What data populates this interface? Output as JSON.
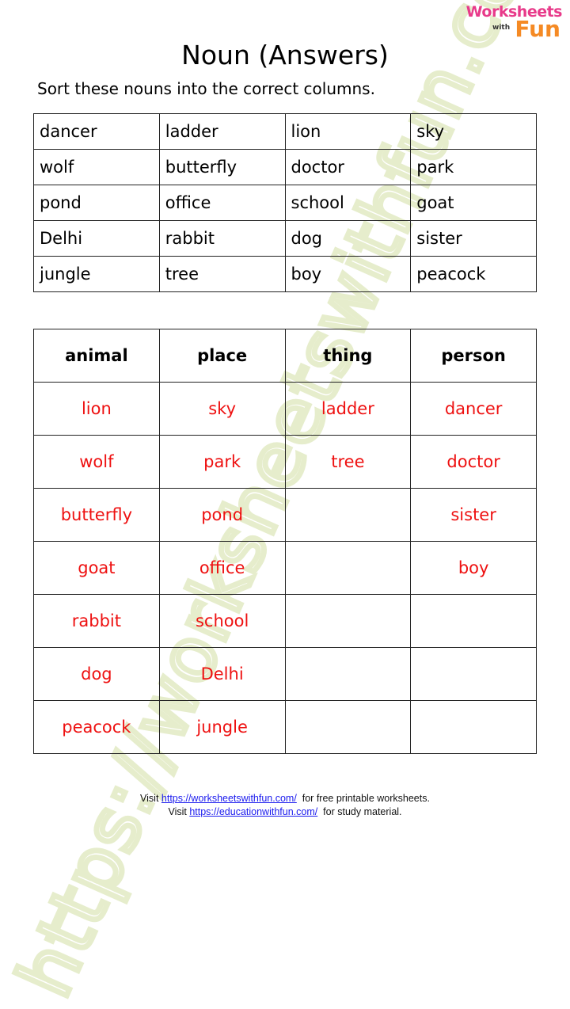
{
  "watermark": "https://worksheetswithfun.com",
  "logo": {
    "line1": "Worksheets",
    "line2": "with",
    "line3": "Fun"
  },
  "title": "Noun (Answers)",
  "instruction": "Sort these nouns into the correct columns.",
  "word_table": [
    [
      "dancer",
      "ladder",
      "lion",
      "sky"
    ],
    [
      "wolf",
      "butterfly",
      "doctor",
      "park"
    ],
    [
      "pond",
      "office",
      "school",
      "goat"
    ],
    [
      "Delhi",
      "rabbit",
      "dog",
      "sister"
    ],
    [
      "jungle",
      "tree",
      "boy",
      "peacock"
    ]
  ],
  "answer_table": {
    "headers": [
      "animal",
      "place",
      "thing",
      "person"
    ],
    "rows": [
      [
        "lion",
        "sky",
        "ladder",
        "dancer"
      ],
      [
        "wolf",
        "park",
        "tree",
        "doctor"
      ],
      [
        "butterfly",
        "pond",
        "",
        "sister"
      ],
      [
        "goat",
        "office",
        "",
        "boy"
      ],
      [
        "rabbit",
        "school",
        "",
        ""
      ],
      [
        "dog",
        "Delhi",
        "",
        ""
      ],
      [
        "peacock",
        "jungle",
        "",
        ""
      ]
    ]
  },
  "footer": {
    "line1_prefix": "Visit ",
    "line1_link": "https://worksheetswithfun.com/",
    "line1_suffix": "  for free printable worksheets.",
    "line2_prefix": "Visit ",
    "line2_link": "https://educationwithfun.com/",
    "line2_suffix": "  for study material."
  },
  "colors": {
    "answer_text": "#ee1111",
    "link": "#1a1aee",
    "watermark": "#e6edcc"
  }
}
